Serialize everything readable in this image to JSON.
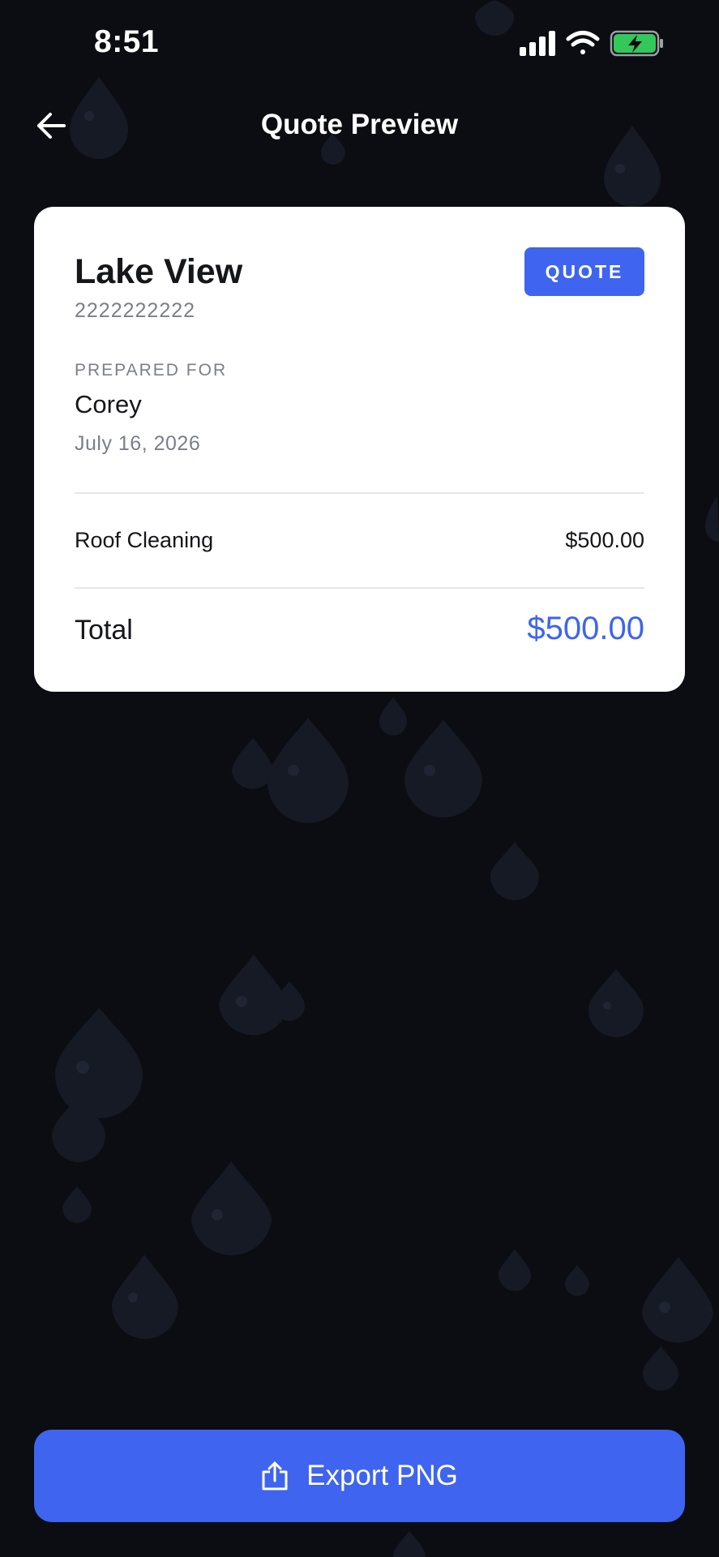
{
  "status": {
    "time": "8:51"
  },
  "nav": {
    "title": "Quote Preview"
  },
  "quote": {
    "title": "Lake View",
    "phone": "2222222222",
    "badge": "QUOTE",
    "prepared_label": "PREPARED FOR",
    "client": "Corey",
    "date": "July 16, 2026",
    "items": [
      {
        "name": "Roof Cleaning",
        "price": "$500.00"
      }
    ],
    "total_label": "Total",
    "total_value": "$500.00"
  },
  "footer": {
    "export_label": "Export PNG"
  },
  "colors": {
    "background": "#0b0d12",
    "accent": "#3f64f0",
    "card": "#ffffff",
    "muted_text": "#7a7f88",
    "drop": "#161b25",
    "battery": "#34c759"
  }
}
